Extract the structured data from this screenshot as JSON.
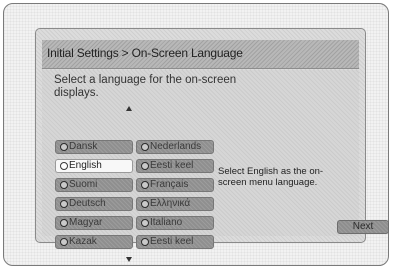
{
  "dialog": {
    "title": "Initial Settings > On-Screen Language",
    "instruction": "Select a language for the on-screen displays.",
    "help_text": "Select English as  the on-screen menu language.",
    "next_label": "Next"
  },
  "languages": {
    "col1": [
      "Dansk",
      "English",
      "Suomi",
      "Deutsch",
      "Magyar",
      "Kazak"
    ],
    "col2": [
      "Nederlands",
      "Eesti keel",
      "Français",
      "Ελληνικά",
      "Italiano",
      "Eesti keel"
    ]
  },
  "selected_language": "English",
  "icons": {
    "scroll_up": "triangle-up-icon",
    "scroll_down": "triangle-down-icon",
    "radio": "radio-icon"
  },
  "colors": {
    "button_default": "#8f8f8f",
    "button_selected": "#f8f8f8",
    "title_bar": "#b8b8b8"
  }
}
